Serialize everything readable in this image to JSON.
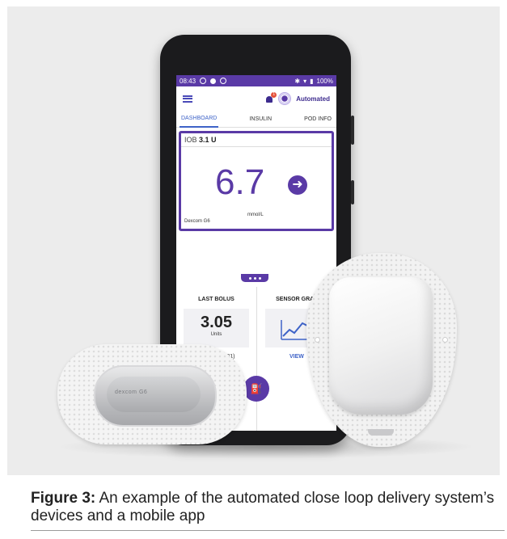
{
  "phone": {
    "status_time": "08:43",
    "status_right": "100%",
    "mode_label": "Automated",
    "tabs": [
      "DASHBOARD",
      "INSULIN",
      "POD INFO"
    ],
    "iob_label": "IOB",
    "iob_value": "3.1 U",
    "glucose_value": "6.7",
    "glucose_unit": "mmol/L",
    "cgm_source": "Dexcom G6",
    "last_bolus_title": "LAST BOLUS",
    "last_bolus_value": "3.05",
    "last_bolus_unit": "Units",
    "last_bolus_date": "04 Aug (08:31)",
    "sensor_graph_title": "SENSOR GRAP",
    "view_label": "VIEW",
    "notification_count": "1"
  },
  "cgm_device": {
    "brand": "dexcom G6"
  },
  "caption": {
    "label": "Figure 3:",
    "text": " An example of the automated close loop delivery system’s devices and a mobile app"
  },
  "colors": {
    "accent": "#5a3aa6",
    "link": "#3e63c8"
  }
}
